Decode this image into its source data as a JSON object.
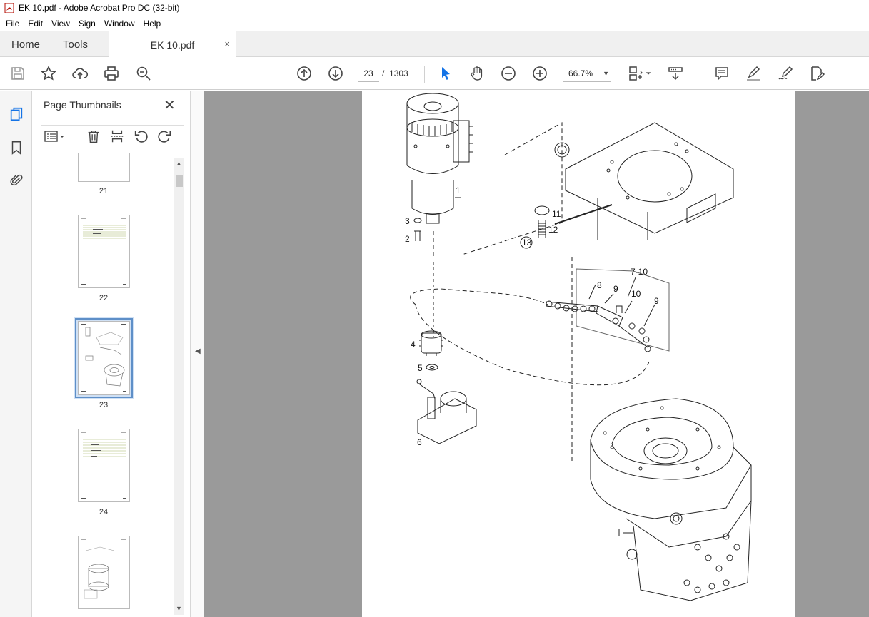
{
  "window": {
    "title": "EK 10.pdf - Adobe Acrobat Pro DC (32-bit)"
  },
  "menu": [
    "File",
    "Edit",
    "View",
    "Sign",
    "Window",
    "Help"
  ],
  "tabs": {
    "home": "Home",
    "tools": "Tools",
    "document": "EK 10.pdf",
    "close": "×"
  },
  "toolbar": {
    "current_page": "23",
    "page_separator": "/",
    "total_pages": "1303",
    "zoom": "66.7%"
  },
  "thumbnail_panel": {
    "title": "Page Thumbnails",
    "close": "✕",
    "pages": [
      {
        "number": "21"
      },
      {
        "number": "22"
      },
      {
        "number": "23",
        "selected": true
      },
      {
        "number": "24"
      }
    ]
  },
  "drawing_callouts": [
    "1",
    "2",
    "3",
    "4",
    "5",
    "6",
    "7-10",
    "8",
    "9",
    "10",
    "9",
    "11",
    "12",
    "13"
  ],
  "colors": {
    "accent": "#1473e6",
    "selection": "#5e8fc8",
    "doc_background": "#9a9a9a"
  }
}
